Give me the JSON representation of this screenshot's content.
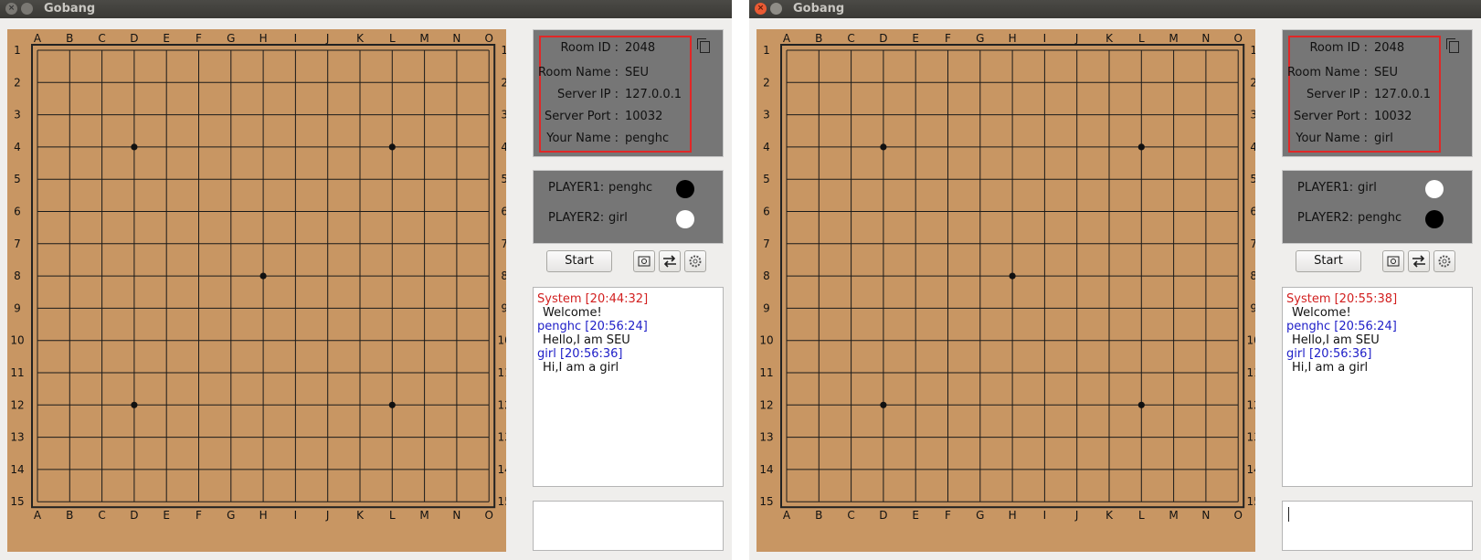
{
  "windows": [
    {
      "id": "win1",
      "title": "Gobang",
      "active": false,
      "room": {
        "id_label": "Room   ID :",
        "id": "2048",
        "name_label": "Room Name :",
        "name": "SEU",
        "ip_label": "Server IP :",
        "ip": "127.0.0.1",
        "port_label": "Server Port :",
        "port": "10032",
        "your_name_label": "Your Name :",
        "your_name": "penghc"
      },
      "players": [
        {
          "label": "PLAYER1:",
          "name": "penghc",
          "stone": "black"
        },
        {
          "label": "PLAYER2:",
          "name": "girl",
          "stone": "white"
        }
      ],
      "start_label": "Start",
      "chat": [
        {
          "kind": "system",
          "text": "System [20:44:32]"
        },
        {
          "kind": "text",
          "text": "Welcome!"
        },
        {
          "kind": "user",
          "text": "penghc [20:56:24]"
        },
        {
          "kind": "text",
          "text": "Hello,I am SEU"
        },
        {
          "kind": "user",
          "text": "girl [20:56:36]"
        },
        {
          "kind": "text",
          "text": "Hi,I am a girl"
        }
      ],
      "input_value": ""
    },
    {
      "id": "win2",
      "title": "Gobang",
      "active": true,
      "room": {
        "id_label": "Room   ID :",
        "id": "2048",
        "name_label": "Room Name :",
        "name": "SEU",
        "ip_label": "Server IP :",
        "ip": "127.0.0.1",
        "port_label": "Server Port :",
        "port": "10032",
        "your_name_label": "Your Name :",
        "your_name": "girl"
      },
      "players": [
        {
          "label": "PLAYER1:",
          "name": "girl",
          "stone": "white"
        },
        {
          "label": "PLAYER2:",
          "name": "penghc",
          "stone": "black"
        }
      ],
      "start_label": "Start",
      "chat": [
        {
          "kind": "system",
          "text": "System [20:55:38]"
        },
        {
          "kind": "text",
          "text": "Welcome!"
        },
        {
          "kind": "user",
          "text": "penghc [20:56:24]"
        },
        {
          "kind": "text",
          "text": "Hello,I am SEU"
        },
        {
          "kind": "user",
          "text": "girl [20:56:36]"
        },
        {
          "kind": "text",
          "text": "Hi,I am a girl"
        }
      ],
      "input_value": ""
    }
  ],
  "board": {
    "columns": [
      "A",
      "B",
      "C",
      "D",
      "E",
      "F",
      "G",
      "H",
      "I",
      "J",
      "K",
      "L",
      "M",
      "N",
      "O"
    ],
    "rows": [
      "1",
      "2",
      "3",
      "4",
      "5",
      "6",
      "7",
      "8",
      "9",
      "10",
      "11",
      "12",
      "13",
      "14",
      "15"
    ],
    "star_points": [
      "D4",
      "L4",
      "H8",
      "D12",
      "L12"
    ]
  },
  "colors": {
    "board": "#c89663",
    "panel": "#767676",
    "highlight": "#e12727",
    "system_text": "#d21f1f",
    "user_text": "#2020c8"
  },
  "icons": [
    "copy-icon",
    "screenshot-icon",
    "swap-icon",
    "settings-icon"
  ]
}
